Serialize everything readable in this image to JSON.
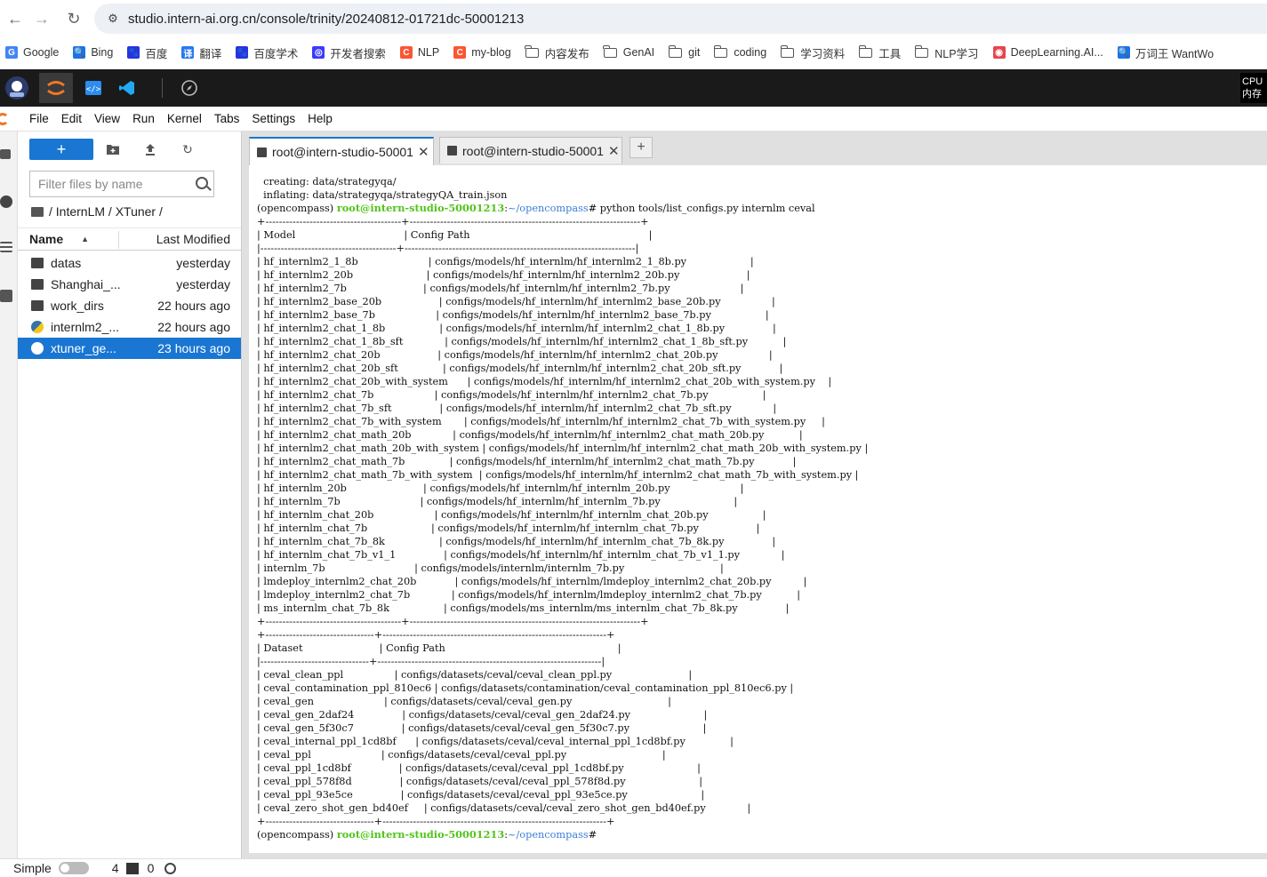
{
  "browser": {
    "url": "studio.intern-ai.org.cn/console/trinity/20240812-01721dc-50001213",
    "bookmarks": [
      {
        "label": "Google",
        "icon": "google-icon",
        "color": "#4285f4",
        "glyph": "G"
      },
      {
        "label": "Bing",
        "icon": "search-icon",
        "color": "#1a73e8",
        "glyph": "🔍"
      },
      {
        "label": "百度",
        "icon": "baidu-icon",
        "color": "#2932e1",
        "glyph": "🐾"
      },
      {
        "label": "翻译",
        "icon": "translate-icon",
        "color": "#2878f0",
        "glyph": "译"
      },
      {
        "label": "百度学术",
        "icon": "baidu-scholar-icon",
        "color": "#2932e1",
        "glyph": "🐾"
      },
      {
        "label": "开发者搜索",
        "icon": "dev-search-icon",
        "color": "#3a3aff",
        "glyph": "◎"
      },
      {
        "label": "NLP",
        "icon": "csdn-icon",
        "color": "#fc5531",
        "glyph": "C"
      },
      {
        "label": "my-blog",
        "icon": "csdn-icon",
        "color": "#fc5531",
        "glyph": "C"
      },
      {
        "label": "内容发布",
        "icon": "folder-icon",
        "folder": true
      },
      {
        "label": "GenAI",
        "icon": "folder-icon",
        "folder": true
      },
      {
        "label": "git",
        "icon": "folder-icon",
        "folder": true
      },
      {
        "label": "coding",
        "icon": "folder-icon",
        "folder": true
      },
      {
        "label": "学习资料",
        "icon": "folder-icon",
        "folder": true
      },
      {
        "label": "工具",
        "icon": "folder-icon",
        "folder": true
      },
      {
        "label": "NLP学习",
        "icon": "folder-icon",
        "folder": true
      },
      {
        "label": "DeepLearning.AI...",
        "icon": "deeplearning-icon",
        "color": "#e5454d",
        "glyph": "◉"
      },
      {
        "label": "万词王 WantWo",
        "icon": "search-icon",
        "color": "#1a73e8",
        "glyph": "🔍"
      }
    ]
  },
  "topbar": {
    "cpu_label": "CPU",
    "mem_label": "内存"
  },
  "menu": [
    "File",
    "Edit",
    "View",
    "Run",
    "Kernel",
    "Tabs",
    "Settings",
    "Help"
  ],
  "filebrowser": {
    "filter_placeholder": "Filter files by name",
    "breadcrumb": "/ InternLM / XTuner /",
    "col_name": "Name",
    "col_modified": "Last Modified",
    "rows": [
      {
        "name": "datas",
        "modified": "yesterday",
        "type": "folder"
      },
      {
        "name": "Shanghai_...",
        "modified": "yesterday",
        "type": "folder"
      },
      {
        "name": "work_dirs",
        "modified": "22 hours ago",
        "type": "folder"
      },
      {
        "name": "internlm2_...",
        "modified": "22 hours ago",
        "type": "python"
      },
      {
        "name": "xtuner_ge...",
        "modified": "23 hours ago",
        "type": "python",
        "selected": true
      }
    ]
  },
  "tabs": [
    {
      "label": "root@intern-studio-50001",
      "active": true
    },
    {
      "label": "root@intern-studio-50001",
      "active": false
    }
  ],
  "terminal": {
    "prompt_env": "(opencompass) ",
    "prompt_host": "root@intern-studio-50001213",
    "prompt_path": "~/opencompass",
    "lines": [
      "  creating: data/strategyqa/",
      "  inflating: data/strategyqa/strategyQA_train.json",
      "#PROMPT#python tools/list_configs.py internlm ceval",
      "+----------------------------------------+--------------------------------------------------------------------+",
      "| Model                                  | Config Path                                                        |",
      "|----------------------------------------+--------------------------------------------------------------------|",
      "| hf_internlm2_1_8b                      | configs/models/hf_internlm/hf_internlm2_1_8b.py                    |",
      "| hf_internlm2_20b                       | configs/models/hf_internlm/hf_internlm2_20b.py                     |",
      "| hf_internlm2_7b                        | configs/models/hf_internlm/hf_internlm2_7b.py                      |",
      "| hf_internlm2_base_20b                  | configs/models/hf_internlm/hf_internlm2_base_20b.py                |",
      "| hf_internlm2_base_7b                   | configs/models/hf_internlm/hf_internlm2_base_7b.py                 |",
      "| hf_internlm2_chat_1_8b                 | configs/models/hf_internlm/hf_internlm2_chat_1_8b.py               |",
      "| hf_internlm2_chat_1_8b_sft             | configs/models/hf_internlm/hf_internlm2_chat_1_8b_sft.py           |",
      "| hf_internlm2_chat_20b                  | configs/models/hf_internlm/hf_internlm2_chat_20b.py                |",
      "| hf_internlm2_chat_20b_sft              | configs/models/hf_internlm/hf_internlm2_chat_20b_sft.py            |",
      "| hf_internlm2_chat_20b_with_system      | configs/models/hf_internlm/hf_internlm2_chat_20b_with_system.py    |",
      "| hf_internlm2_chat_7b                   | configs/models/hf_internlm/hf_internlm2_chat_7b.py                 |",
      "| hf_internlm2_chat_7b_sft               | configs/models/hf_internlm/hf_internlm2_chat_7b_sft.py             |",
      "| hf_internlm2_chat_7b_with_system       | configs/models/hf_internlm/hf_internlm2_chat_7b_with_system.py     |",
      "| hf_internlm2_chat_math_20b             | configs/models/hf_internlm/hf_internlm2_chat_math_20b.py           |",
      "| hf_internlm2_chat_math_20b_with_system | configs/models/hf_internlm/hf_internlm2_chat_math_20b_with_system.py |",
      "| hf_internlm2_chat_math_7b              | configs/models/hf_internlm/hf_internlm2_chat_math_7b.py            |",
      "| hf_internlm2_chat_math_7b_with_system  | configs/models/hf_internlm/hf_internlm2_chat_math_7b_with_system.py |",
      "| hf_internlm_20b                        | configs/models/hf_internlm/hf_internlm_20b.py                      |",
      "| hf_internlm_7b                         | configs/models/hf_internlm/hf_internlm_7b.py                       |",
      "| hf_internlm_chat_20b                   | configs/models/hf_internlm/hf_internlm_chat_20b.py                 |",
      "| hf_internlm_chat_7b                    | configs/models/hf_internlm/hf_internlm_chat_7b.py                  |",
      "| hf_internlm_chat_7b_8k                 | configs/models/hf_internlm/hf_internlm_chat_7b_8k.py               |",
      "| hf_internlm_chat_7b_v1_1               | configs/models/hf_internlm/hf_internlm_chat_7b_v1_1.py             |",
      "| internlm_7b                            | configs/models/internlm/internlm_7b.py                              |",
      "| lmdeploy_internlm2_chat_20b            | configs/models/hf_internlm/lmdeploy_internlm2_chat_20b.py          |",
      "| lmdeploy_internlm2_chat_7b             | configs/models/hf_internlm/lmdeploy_internlm2_chat_7b.py           |",
      "| ms_internlm_chat_7b_8k                 | configs/models/ms_internlm/ms_internlm_chat_7b_8k.py               |",
      "+----------------------------------------+--------------------------------------------------------------------+",
      "+--------------------------------+------------------------------------------------------------------+",
      "| Dataset                        | Config Path                                                      |",
      "|--------------------------------+------------------------------------------------------------------|",
      "| ceval_clean_ppl                | configs/datasets/ceval/ceval_clean_ppl.py                        |",
      "| ceval_contamination_ppl_810ec6 | configs/datasets/contamination/ceval_contamination_ppl_810ec6.py |",
      "| ceval_gen                      | configs/datasets/ceval/ceval_gen.py                              |",
      "| ceval_gen_2daf24               | configs/datasets/ceval/ceval_gen_2daf24.py                       |",
      "| ceval_gen_5f30c7               | configs/datasets/ceval/ceval_gen_5f30c7.py                       |",
      "| ceval_internal_ppl_1cd8bf      | configs/datasets/ceval/ceval_internal_ppl_1cd8bf.py              |",
      "| ceval_ppl                      | configs/datasets/ceval/ceval_ppl.py                              |",
      "| ceval_ppl_1cd8bf               | configs/datasets/ceval/ceval_ppl_1cd8bf.py                       |",
      "| ceval_ppl_578f8d               | configs/datasets/ceval/ceval_ppl_578f8d.py                       |",
      "| ceval_ppl_93e5ce               | configs/datasets/ceval/ceval_ppl_93e5ce.py                       |",
      "| ceval_zero_shot_gen_bd40ef     | configs/datasets/ceval/ceval_zero_shot_gen_bd40ef.py             |",
      "+--------------------------------+------------------------------------------------------------------+",
      "#PROMPT#"
    ]
  },
  "statusbar": {
    "mode_label": "Simple",
    "terminals_count": "4",
    "kernels_count": "0"
  },
  "colors": {
    "accent": "#1976d2",
    "prompt_host": "#52c41a",
    "prompt_path": "#3b7dd8"
  }
}
